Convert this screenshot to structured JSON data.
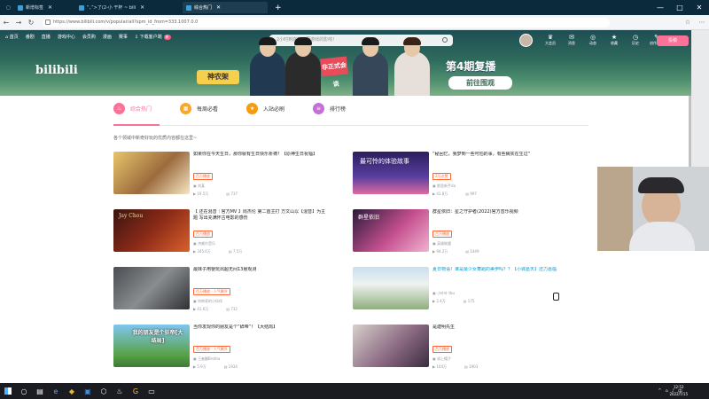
{
  "browser": {
    "tabs": [
      {
        "label": "新增标签",
        "active": false
      },
      {
        "label": "“、”>了(2-小 干杯 ~ bili",
        "active": false
      },
      {
        "label": "综合热门",
        "active": true
      }
    ],
    "new_tab": "+",
    "window_controls": [
      "—",
      "□",
      "✕"
    ],
    "url": "https://www.bilibili.com/v/popular/all?spm_id_from=333.1007.0.0",
    "nav": [
      "←",
      "→",
      "↻"
    ],
    "toolbar_icons": [
      "☆",
      "⋯"
    ]
  },
  "topnav": {
    "items": [
      "首页",
      "番剧",
      "直播",
      "游戏中心",
      "会员购",
      "漫画",
      "赛事"
    ],
    "download": "下载客户端",
    "download_badge": "新",
    "search_placeholder": "2小时到底对韩国游戏的影响！",
    "right_icons": [
      {
        "glyph": "♛",
        "label": "大会员"
      },
      {
        "glyph": "✉",
        "label": "消息"
      },
      {
        "glyph": "◎",
        "label": "动态"
      },
      {
        "glyph": "★",
        "label": "收藏"
      },
      {
        "glyph": "◷",
        "label": "历史"
      },
      {
        "glyph": "✎",
        "label": "创作中心"
      }
    ],
    "upload": "投稿"
  },
  "banner": {
    "logo": "bilibili",
    "tag": "神农架",
    "show": "非正式会谈",
    "episode": "第4期复播",
    "cta": "前往围观"
  },
  "tabs": [
    {
      "label": "综合热门",
      "icon": "fire-icon",
      "color": "#fb7299",
      "selected": true
    },
    {
      "label": "每周必看",
      "icon": "calendar-icon",
      "color": "#f9a825",
      "selected": false
    },
    {
      "label": "入站必刷",
      "icon": "star-icon",
      "color": "#f39c12",
      "selected": false
    },
    {
      "label": "排行榜",
      "icon": "ranking-icon",
      "color": "#c471d5",
      "selected": false
    }
  ],
  "subtitle": "各个领域中新奇好玩的优质内容都在这里~",
  "videos": [
    {
      "title": "如果你在今天生日，那你就有生日快乐祈祷！【原神生日祝福】",
      "tag": "百万播放",
      "up": "刘某",
      "views": "19.5万",
      "danmaku": "737",
      "link": false
    },
    {
      "title": "“秘回忆，我梦到一些可怕的事，有些病实在生过”",
      "tag": "2万点赞",
      "up": "斯里新手da",
      "views": "41.8万",
      "danmaku": "997",
      "link": false
    },
    {
      "title": "【 还在混音｜官方MV 】周杰伦 第二首主打 方文山以【混音】为主题 写出充满怀古电影的感伤",
      "tag": "百万播放",
      "up": "杰威尔音乐",
      "views": "345.6万",
      "danmaku": "7.5万",
      "link": false
    },
    {
      "title": "群星依旧：星之守护者(2022)官方音乐视频",
      "tag": "百万播放",
      "up": "英雄联盟",
      "views": "94.2万",
      "danmaku": "1449",
      "link": false
    },
    {
      "title": "最妹子用梗玩出超无间13悬观测",
      "tag": "百万播放 · 人气飙升",
      "up": "何帅家的小伙伴",
      "views": "41.6万",
      "danmaku": "732",
      "link": false
    },
    {
      "title": "夏日物语！谁是最少女舞蹈的美伊吗？？【小城葛天】还力嘉临",
      "tag": "",
      "up": "小叶叶 tbu",
      "views": "2.4万",
      "danmaku": "175",
      "link": true
    },
    {
      "title": "当你发现你的朋友是个”辞帝“！【大结局】",
      "tag": "百万播放 · 人气飙升",
      "up": "王者翻Brotha",
      "views": "5.9万",
      "danmaku": "1934",
      "link": false
    },
    {
      "title": "是建明先生",
      "tag": "百万播放",
      "up": "如上帽子",
      "views": "104万",
      "danmaku": "1903",
      "link": false
    }
  ],
  "thumb_texts": [
    "最可怜的体验故事",
    "Jay Chou",
    "群星依旧",
    "我的朋友是个狂帝[大结局]"
  ],
  "taskbar": {
    "icons": [
      "⊞",
      "○",
      "▤",
      "e",
      "◆",
      "▣",
      "⬡",
      "♨",
      "G",
      "▭"
    ],
    "tray": [
      "^",
      "⌂",
      "♪",
      "中"
    ],
    "time": "12:52",
    "date": "2022/7/15"
  },
  "colors": {
    "accent": "#fb7299",
    "link": "#00a1d6",
    "tag": "#ff6633"
  }
}
